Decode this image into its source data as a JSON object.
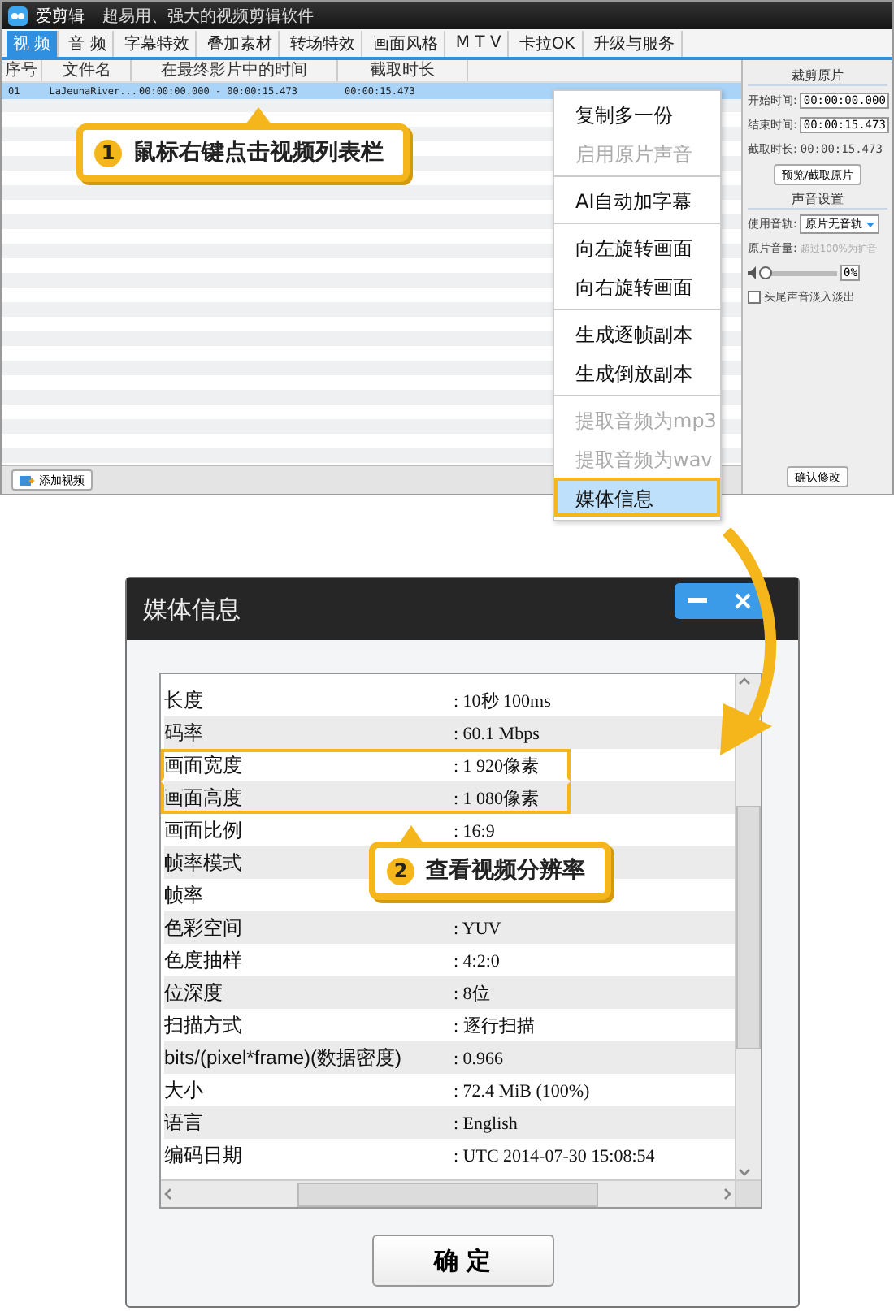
{
  "app": {
    "title": "爱剪辑",
    "slogan": "超易用、强大的视频剪辑软件",
    "tabs": [
      {
        "label": "视 频",
        "selected": true
      },
      {
        "label": "音 频",
        "selected": false
      },
      {
        "label": "字幕特效",
        "selected": false
      },
      {
        "label": "叠加素材",
        "selected": false
      },
      {
        "label": "转场特效",
        "selected": false
      },
      {
        "label": "画面风格",
        "selected": false
      },
      {
        "label": "M T V",
        "selected": false
      },
      {
        "label": "卡拉OK",
        "selected": false
      },
      {
        "label": "升级与服务",
        "selected": false
      }
    ],
    "table": {
      "columns": [
        "序号",
        "文件名",
        "在最终影片中的时间",
        "截取时长"
      ],
      "rows": [
        {
          "cells": [
            "01",
            "LaJeunaRiver...",
            "00:00:00.000 - 00:00:15.473",
            "00:00:15.473"
          ],
          "selected": true
        }
      ]
    },
    "add_button": "添加视频",
    "panel": {
      "clip_heading": "裁剪原片",
      "start_label": "开始时间:",
      "start_value": "00:00:00.000",
      "end_label": "结束时间:",
      "end_value": "00:00:15.473",
      "duration_label": "截取时长:",
      "duration_value": "00:00:15.473",
      "preview_button": "预览/截取原片",
      "sound_heading": "声音设置",
      "track_label": "使用音轨:",
      "track_value": "原片无音轨",
      "volume_label": "原片音量:",
      "volume_hint": "超过100%为扩音",
      "volume": {
        "level": 0,
        "value": "0%"
      },
      "fade": {
        "label": "头尾声音淡入淡出",
        "checked": false
      },
      "confirm_button": "确认修改"
    }
  },
  "context_menu": {
    "groups": [
      [
        {
          "label": "复制多一份",
          "disabled": false,
          "selected": false
        },
        {
          "label": "启用原片声音",
          "disabled": true,
          "selected": false
        }
      ],
      [
        {
          "label": "AI自动加字幕",
          "disabled": false,
          "selected": false
        }
      ],
      [
        {
          "label": "向左旋转画面",
          "disabled": false,
          "selected": false
        },
        {
          "label": "向右旋转画面",
          "disabled": false,
          "selected": false
        }
      ],
      [
        {
          "label": "生成逐帧副本",
          "disabled": false,
          "selected": false
        },
        {
          "label": "生成倒放副本",
          "disabled": false,
          "selected": false
        }
      ],
      [
        {
          "label": "提取音频为mp3",
          "disabled": true,
          "selected": false
        },
        {
          "label": "提取音频为wav",
          "disabled": true,
          "selected": false
        },
        {
          "label": "媒体信息",
          "disabled": false,
          "selected": true
        }
      ]
    ]
  },
  "callouts": [
    {
      "number": "1",
      "text": "鼠标右键点击视频列表栏"
    },
    {
      "number": "2",
      "text": "查看视频分辨率"
    }
  ],
  "dialog": {
    "title": "媒体信息",
    "ok_button": "确 定",
    "rows": [
      {
        "label": "长度",
        "value": ": 10秒 100ms",
        "highlighted": false
      },
      {
        "label": "码率",
        "value": ": 60.1 Mbps",
        "highlighted": false
      },
      {
        "label": "画面宽度",
        "value": ": 1 920像素",
        "highlighted": true
      },
      {
        "label": "画面高度",
        "value": ": 1 080像素",
        "highlighted": true
      },
      {
        "label": "画面比例",
        "value": ": 16:9",
        "highlighted": false
      },
      {
        "label": "帧率模式",
        "highlighted": false
      },
      {
        "label": "帧率",
        "highlighted": false
      },
      {
        "label": "色彩空间",
        "value": ": YUV",
        "highlighted": false
      },
      {
        "label": "色度抽样",
        "value": ": 4:2:0",
        "highlighted": false
      },
      {
        "label": "位深度",
        "value": ": 8位",
        "highlighted": false
      },
      {
        "label": "扫描方式",
        "value": ": 逐行扫描",
        "highlighted": false
      },
      {
        "label": "bits/(pixel*frame)(数据密度)",
        "value": ": 0.966",
        "highlighted": false
      },
      {
        "label": "大小",
        "value": ": 72.4 MiB (100%)",
        "highlighted": false
      },
      {
        "label": "语言",
        "value": ": English",
        "highlighted": false
      },
      {
        "label": "编码日期",
        "value": ": UTC 2014-07-30 15:08:54",
        "highlighted": false
      }
    ]
  }
}
